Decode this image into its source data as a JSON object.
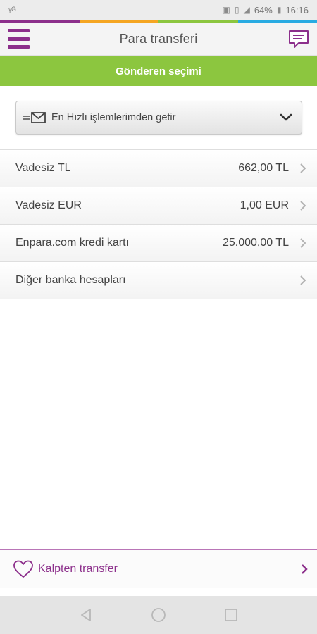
{
  "status_bar": {
    "battery": "64%",
    "time": "16:16"
  },
  "colors": {
    "brand_purple": "#8c2f8b",
    "section_green": "#8cc63f",
    "stripe": [
      "#8c2f8b",
      "#f5a623",
      "#8cc63f",
      "#29abe2"
    ]
  },
  "header": {
    "title": "Para transferi",
    "menu_icon": "hamburger-menu-icon",
    "chat_icon": "chat-bubble-icon"
  },
  "section": {
    "title": "Gönderen seçimi"
  },
  "quick_select": {
    "label": "En Hızlı işlemlerimden getir",
    "icon": "envelope-icon"
  },
  "accounts": [
    {
      "name": "Vadesiz TL",
      "amount": "662,00 TL"
    },
    {
      "name": "Vadesiz EUR",
      "amount": "1,00 EUR"
    },
    {
      "name": "Enpara.com kredi kartı",
      "amount": "25.000,00 TL"
    },
    {
      "name": "Diğer banka hesapları",
      "amount": ""
    }
  ],
  "bottom_action": {
    "label": "Kalpten transfer",
    "icon": "heart-icon"
  },
  "nav": {
    "back_icon": "back-triangle-icon",
    "home_icon": "home-circle-icon",
    "recents_icon": "recents-square-icon"
  }
}
